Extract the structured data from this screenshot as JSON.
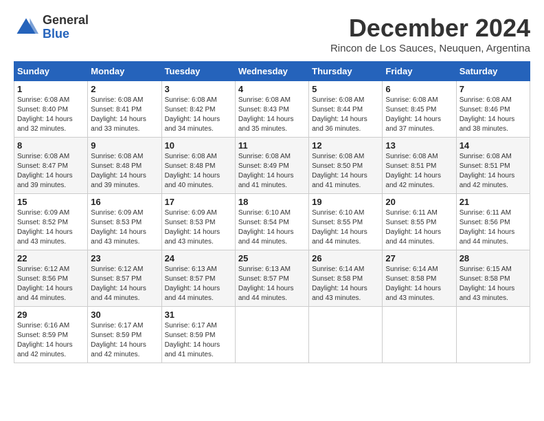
{
  "logo": {
    "general": "General",
    "blue": "Blue"
  },
  "title": {
    "month": "December 2024",
    "location": "Rincon de Los Sauces, Neuquen, Argentina"
  },
  "headers": [
    "Sunday",
    "Monday",
    "Tuesday",
    "Wednesday",
    "Thursday",
    "Friday",
    "Saturday"
  ],
  "weeks": [
    [
      {
        "day": "1",
        "sunrise": "6:08 AM",
        "sunset": "8:40 PM",
        "daylight": "14 hours and 32 minutes."
      },
      {
        "day": "2",
        "sunrise": "6:08 AM",
        "sunset": "8:41 PM",
        "daylight": "14 hours and 33 minutes."
      },
      {
        "day": "3",
        "sunrise": "6:08 AM",
        "sunset": "8:42 PM",
        "daylight": "14 hours and 34 minutes."
      },
      {
        "day": "4",
        "sunrise": "6:08 AM",
        "sunset": "8:43 PM",
        "daylight": "14 hours and 35 minutes."
      },
      {
        "day": "5",
        "sunrise": "6:08 AM",
        "sunset": "8:44 PM",
        "daylight": "14 hours and 36 minutes."
      },
      {
        "day": "6",
        "sunrise": "6:08 AM",
        "sunset": "8:45 PM",
        "daylight": "14 hours and 37 minutes."
      },
      {
        "day": "7",
        "sunrise": "6:08 AM",
        "sunset": "8:46 PM",
        "daylight": "14 hours and 38 minutes."
      }
    ],
    [
      {
        "day": "8",
        "sunrise": "6:08 AM",
        "sunset": "8:47 PM",
        "daylight": "14 hours and 39 minutes."
      },
      {
        "day": "9",
        "sunrise": "6:08 AM",
        "sunset": "8:48 PM",
        "daylight": "14 hours and 39 minutes."
      },
      {
        "day": "10",
        "sunrise": "6:08 AM",
        "sunset": "8:48 PM",
        "daylight": "14 hours and 40 minutes."
      },
      {
        "day": "11",
        "sunrise": "6:08 AM",
        "sunset": "8:49 PM",
        "daylight": "14 hours and 41 minutes."
      },
      {
        "day": "12",
        "sunrise": "6:08 AM",
        "sunset": "8:50 PM",
        "daylight": "14 hours and 41 minutes."
      },
      {
        "day": "13",
        "sunrise": "6:08 AM",
        "sunset": "8:51 PM",
        "daylight": "14 hours and 42 minutes."
      },
      {
        "day": "14",
        "sunrise": "6:08 AM",
        "sunset": "8:51 PM",
        "daylight": "14 hours and 42 minutes."
      }
    ],
    [
      {
        "day": "15",
        "sunrise": "6:09 AM",
        "sunset": "8:52 PM",
        "daylight": "14 hours and 43 minutes."
      },
      {
        "day": "16",
        "sunrise": "6:09 AM",
        "sunset": "8:53 PM",
        "daylight": "14 hours and 43 minutes."
      },
      {
        "day": "17",
        "sunrise": "6:09 AM",
        "sunset": "8:53 PM",
        "daylight": "14 hours and 43 minutes."
      },
      {
        "day": "18",
        "sunrise": "6:10 AM",
        "sunset": "8:54 PM",
        "daylight": "14 hours and 44 minutes."
      },
      {
        "day": "19",
        "sunrise": "6:10 AM",
        "sunset": "8:55 PM",
        "daylight": "14 hours and 44 minutes."
      },
      {
        "day": "20",
        "sunrise": "6:11 AM",
        "sunset": "8:55 PM",
        "daylight": "14 hours and 44 minutes."
      },
      {
        "day": "21",
        "sunrise": "6:11 AM",
        "sunset": "8:56 PM",
        "daylight": "14 hours and 44 minutes."
      }
    ],
    [
      {
        "day": "22",
        "sunrise": "6:12 AM",
        "sunset": "8:56 PM",
        "daylight": "14 hours and 44 minutes."
      },
      {
        "day": "23",
        "sunrise": "6:12 AM",
        "sunset": "8:57 PM",
        "daylight": "14 hours and 44 minutes."
      },
      {
        "day": "24",
        "sunrise": "6:13 AM",
        "sunset": "8:57 PM",
        "daylight": "14 hours and 44 minutes."
      },
      {
        "day": "25",
        "sunrise": "6:13 AM",
        "sunset": "8:57 PM",
        "daylight": "14 hours and 44 minutes."
      },
      {
        "day": "26",
        "sunrise": "6:14 AM",
        "sunset": "8:58 PM",
        "daylight": "14 hours and 43 minutes."
      },
      {
        "day": "27",
        "sunrise": "6:14 AM",
        "sunset": "8:58 PM",
        "daylight": "14 hours and 43 minutes."
      },
      {
        "day": "28",
        "sunrise": "6:15 AM",
        "sunset": "8:58 PM",
        "daylight": "14 hours and 43 minutes."
      }
    ],
    [
      {
        "day": "29",
        "sunrise": "6:16 AM",
        "sunset": "8:59 PM",
        "daylight": "14 hours and 42 minutes."
      },
      {
        "day": "30",
        "sunrise": "6:17 AM",
        "sunset": "8:59 PM",
        "daylight": "14 hours and 42 minutes."
      },
      {
        "day": "31",
        "sunrise": "6:17 AM",
        "sunset": "8:59 PM",
        "daylight": "14 hours and 41 minutes."
      },
      null,
      null,
      null,
      null
    ]
  ],
  "labels": {
    "sunrise": "Sunrise:",
    "sunset": "Sunset:",
    "daylight": "Daylight:"
  }
}
